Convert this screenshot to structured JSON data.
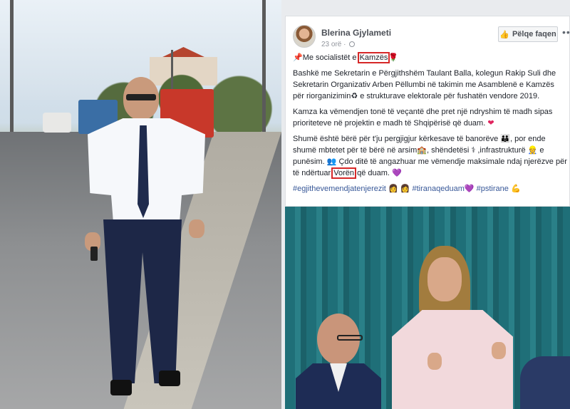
{
  "post": {
    "author": "Blerina Gjylameti",
    "time": "23 orë ·",
    "like_page_label": "Pëlqe faqen",
    "more_label": "•••",
    "line1_pre": "Me socialistët e ",
    "line1_hl": "Kamzës",
    "para1": "Bashkë me Sekretarin e Përgjithshëm Taulant Balla, kolegun Rakip Suli dhe Sekretarin Organizativ Arben Pëllumbi në takimin me Asamblenë e Kamzës për riorganizimin",
    "para1_end": " e strukturave elektorale për fushatën vendore 2019.",
    "para2": "Kamza ka vëmendjen tonë të veçantë dhe pret një ndryshim të madh sipas prioriteteve në projektin e madh të Shqipërisë që duam.",
    "para3_a": "Shumë është bërë për t'ju pergjigjur kërkesave të banorëve",
    "para3_b": ", por ende shumë mbtetet për të bërë në arsim",
    "para3_c": ", shëndetësi",
    "para3_d": " ,infrastrukturë",
    "para3_e": " e punësim.",
    "para3_f": " Çdo ditë të angazhuar me vëmendje maksimale ndaj njerëzve për të ndërtuar ",
    "para3_hl": "Vorën",
    "para3_g": " që duam.",
    "hashtag1": "#egjithevemendjatenjerezit",
    "hashtag2": "#tiranaqeduam",
    "hashtag3": "#pstirane"
  },
  "icons": {
    "pin": "pushpin-icon",
    "rose": "rose-icon",
    "heart": "red-heart-icon",
    "purple_heart": "purple-heart-icon",
    "thumb": "thumbs-up-icon",
    "globe": "globe-icon"
  },
  "colors": {
    "highlight_box": "#d62828",
    "hashtag": "#385898",
    "facebook_bg": "#e9ebee"
  }
}
